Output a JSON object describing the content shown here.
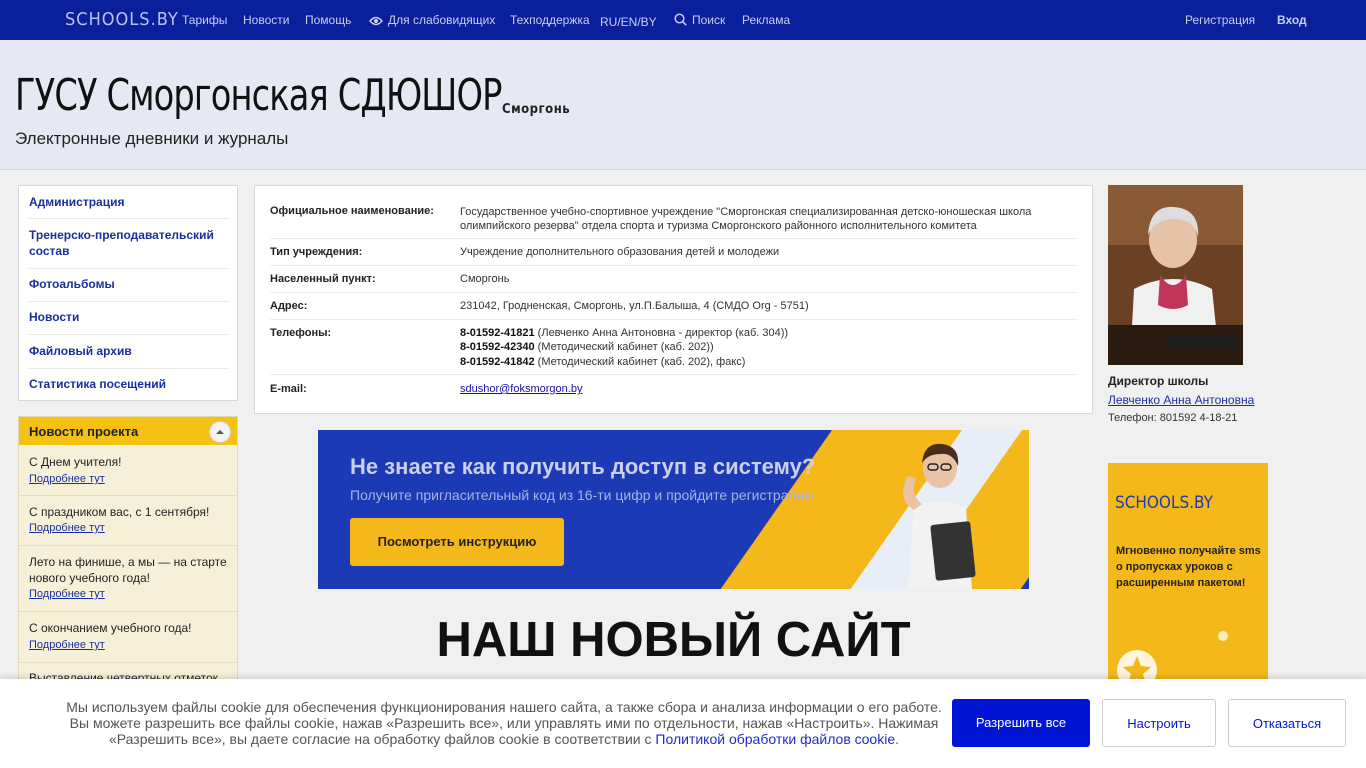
{
  "topbar": {
    "logo": "SCHOOLS.BY",
    "nav": [
      "Тарифы",
      "Новости",
      "Помощь",
      "Для слабовидящих",
      "Техподдержка",
      "RU/EN/BY",
      "Поиск",
      "Реклама"
    ],
    "register": "Регистрация",
    "login": "Вход"
  },
  "header": {
    "title": "ГУСУ Сморгонская СДЮШОР",
    "city": "Сморгонь",
    "subtitle": "Электронные дневники и журналы"
  },
  "sidebar": {
    "items": [
      "Администрация",
      "Тренерско-преподавательский состав",
      "Фотоальбомы",
      "Новости",
      "Файловый архив",
      "Статистика посещений"
    ]
  },
  "news": {
    "title": "Новости проекта",
    "more": "Подробнее тут",
    "items": [
      "С Днем учителя!",
      "С праздником вас, с 1 сентября!",
      "Лето на финише, а мы — на старте нового учебного года!",
      "С окончанием учебного года!",
      "Выставление четвертных отметок"
    ]
  },
  "info": {
    "rows": [
      {
        "label": "Официальное наименование:",
        "value": "Государственное учебно-спортивное учреждение \"Сморгонская специализированная детско-юношеская школа олимпийского резерва\" отдела спорта и туризма Сморгонского районного исполнительного комитета"
      },
      {
        "label": "Тип учреждения:",
        "value": "Учреждение дополнительного образования детей и молодежи"
      },
      {
        "label": "Населенный пункт:",
        "value": "Сморгонь"
      },
      {
        "label": "Адрес:",
        "value": "231042, Гродненская, Сморгонь, ул.П.Балыша, 4 (СМДО Org - 5751)"
      },
      {
        "label": "Телефоны:",
        "value": ""
      },
      {
        "label": "E-mail:",
        "value": "sdushor@foksmorgon.by"
      }
    ],
    "phones": [
      {
        "number": "8-01592-41821",
        "note": " (Левченко Анна Антоновна - директор (каб. 304))"
      },
      {
        "number": "8-01592-42340",
        "note": " (Методический кабинет (каб. 202))"
      },
      {
        "number": "8-01592-41842",
        "note": " (Методический кабинет (каб. 202), факс)"
      }
    ]
  },
  "banner": {
    "heading": "Не знаете как получить доступ в систему?",
    "sub": "Получите пригласительный код из 16-ти цифр и пройдите регистрацию",
    "button": "Посмотреть инструкцию"
  },
  "new_site": "НАШ НОВЫЙ САЙТ",
  "director": {
    "role": "Директор школы",
    "name": "Левченко Анна Антоновна",
    "phone": "Телефон: 801592 4-18-21"
  },
  "promo": {
    "logo": "SCHOOLS.BY",
    "text": "Мгновенно получайте sms о пропусках уроков с расширенным пакетом!"
  },
  "cookie": {
    "text": "Мы используем файлы cookie для обеспечения функционирования нашего сайта, а также сбора и анализа информации о его работе. Вы можете разрешить все файлы cookie, нажав «Разрешить все», или управлять ими по отдельности, нажав «Настроить». Нажимая «Разрешить все», вы даете согласие на обработку файлов cookie в соответствии с ",
    "link": "Политикой обработки файлов cookie",
    "end": ".",
    "allow": "Разрешить все",
    "configure": "Настроить",
    "decline": "Отказаться"
  },
  "colors": {
    "topbar": "#0a1f9c",
    "accent": "#f4b81a",
    "primary_button": "#0015d6"
  }
}
